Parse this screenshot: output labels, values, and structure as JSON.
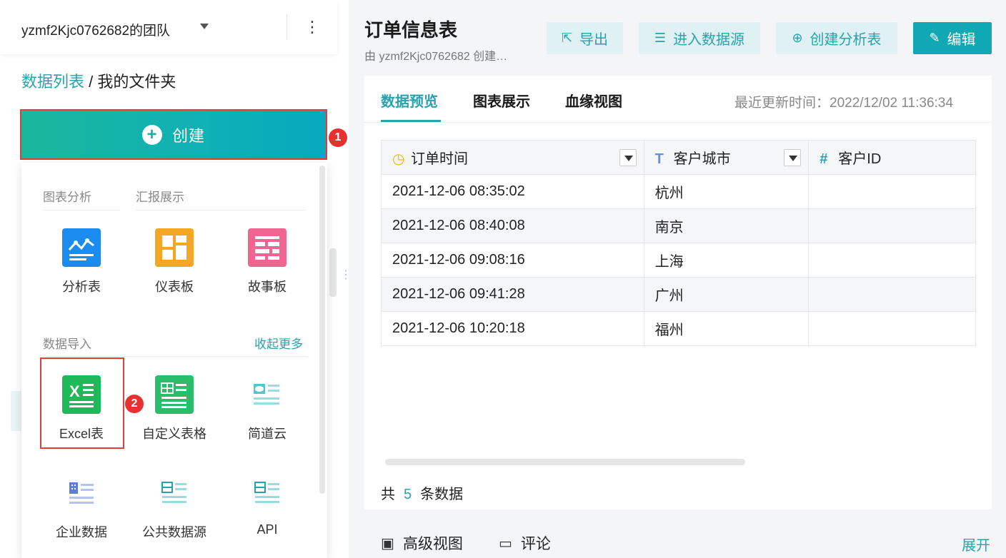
{
  "team": {
    "name": "yzmf2Kjc0762682的团队",
    "more_icon": "⋮"
  },
  "breadcrumb": {
    "root": "数据列表",
    "separator": " / ",
    "current": "我的文件夹"
  },
  "create": {
    "label": "创建",
    "badge": "1"
  },
  "menu": {
    "sections": {
      "chart_analysis": "图表分析",
      "report": "汇报展示",
      "data_import": "数据导入",
      "collapse": "收起更多"
    },
    "tiles": [
      {
        "label": "分析表",
        "icon": "analysis-table-icon",
        "color": "#1a8cf0"
      },
      {
        "label": "仪表板",
        "icon": "dashboard-icon",
        "color": "#f5a623"
      },
      {
        "label": "故事板",
        "icon": "storyboard-icon",
        "color": "#f0658f"
      },
      {
        "label": "Excel表",
        "icon": "excel-icon",
        "color": "#1fb95a"
      },
      {
        "label": "自定义表格",
        "icon": "custom-table-icon",
        "color": "#2bbd6a"
      },
      {
        "label": "简道云",
        "icon": "jiandaoyun-icon",
        "color": "#3cb8c8"
      },
      {
        "label": "企业数据",
        "icon": "enterprise-data-icon",
        "color": "#5b7fd6"
      },
      {
        "label": "公共数据源",
        "icon": "public-datasource-icon",
        "color": "#2aa2ad"
      },
      {
        "label": "API",
        "icon": "api-icon",
        "color": "#2aa2ad"
      }
    ],
    "excel_badge": "2"
  },
  "page": {
    "title": "订单信息表",
    "subtitle": "由 yzmf2Kjc0762682 创建…",
    "actions": {
      "export": "导出",
      "enter_source": "进入数据源",
      "create_analysis": "创建分析表",
      "edit": "编辑"
    }
  },
  "tabs": {
    "preview": "数据预览",
    "chart": "图表展示",
    "lineage": "血缘视图"
  },
  "updated": "最近更新时间：2022/12/02 11:36:34",
  "table": {
    "columns": [
      {
        "label": "订单时间",
        "type_icon": "clock-icon"
      },
      {
        "label": "客户城市",
        "type_icon": "text-type-icon"
      },
      {
        "label": "客户ID",
        "type_icon": "number-type-icon"
      }
    ],
    "rows": [
      [
        "2021-12-06 08:35:02",
        "杭州",
        ""
      ],
      [
        "2021-12-06 08:40:08",
        "南京",
        ""
      ],
      [
        "2021-12-06 09:08:16",
        "上海",
        ""
      ],
      [
        "2021-12-06 09:41:28",
        "广州",
        ""
      ],
      [
        "2021-12-06 10:20:18",
        "福州",
        ""
      ]
    ]
  },
  "count": {
    "prefix": "共",
    "value": "5",
    "suffix": "条数据"
  },
  "footer": {
    "advanced": "高级视图",
    "comment": "评论",
    "expand": "展开"
  }
}
